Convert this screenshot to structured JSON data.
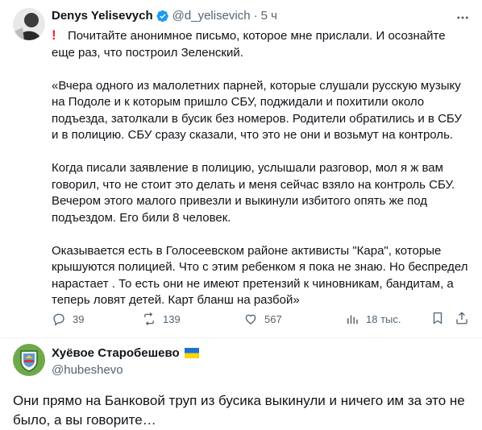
{
  "tweet1": {
    "author_name": "Denys Yelisevych",
    "handle": "@d_yelisevich",
    "time": "5 ч",
    "intro": "Почитайте анонимное письмо, которое мне прислали. И осознайте еще раз, что построил Зеленский.",
    "paragraphs": [
      "«Вчера одного из малолетних парней, которые слушали русскую музыку на Подоле и к которым пришло СБУ, поджидали и похитили около подъезда, затолкали в бусик без номеров. Родители обратились и в СБУ и в полицию. СБУ сразу сказали, что это не они и возьмут на контроль.",
      "Когда писали заявление в полицию, услышали разговор, мол я ж вам говорил, что не стоит это делать и меня сейчас взяло на контроль СБУ. Вечером этого малого привезли и выкинули избитого опять же под подъездом. Его били 8 человек.",
      "Оказывается есть в Голосеевском районе активисты \"Кара\", которые крышуются полицией. Что с этим ребенком я пока не знаю. Но беспредел нарастает . То есть они не имеют претензий к чиновникам, бандитам, а теперь ловят детей. Карт бланш на разбой»"
    ],
    "replies": "39",
    "reposts": "139",
    "likes": "567",
    "views": "18 тыс."
  },
  "tweet2": {
    "author_name": "Хуёвое Старобешево",
    "handle": "@hubeshevo",
    "text": "Они прямо на Банковой труп из бусика выкинули и ничего им за это не было, а вы говорите…"
  },
  "colors": {
    "text": "#0f1419",
    "muted": "#536471",
    "verified": "#1d9bf0",
    "alert": "#f4212e"
  }
}
